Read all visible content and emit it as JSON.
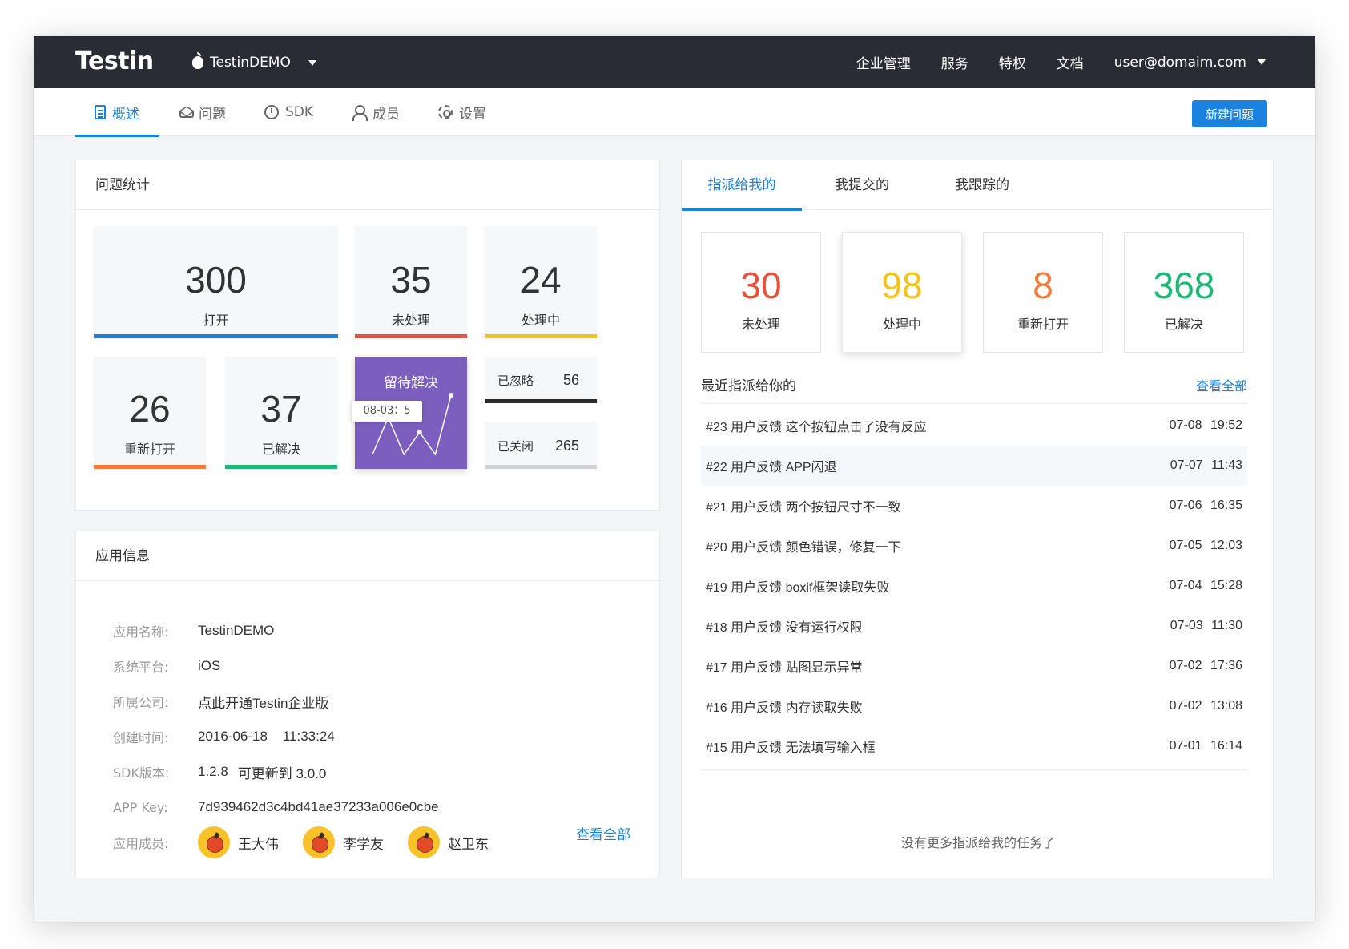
{
  "header": {
    "logo": "Testin",
    "app_name": "TestinDEMO",
    "nav": [
      "企业管理",
      "服务",
      "特权",
      "文档"
    ],
    "user": "user@domaim.com"
  },
  "subnav": {
    "tabs": [
      {
        "label": "概述",
        "icon": "doc-icon"
      },
      {
        "label": "问题",
        "icon": "layers-icon"
      },
      {
        "label": "SDK",
        "icon": "clock-icon"
      },
      {
        "label": "成员",
        "icon": "user-icon"
      },
      {
        "label": "设置",
        "icon": "gear-icon"
      }
    ],
    "new_issue": "新建问题"
  },
  "stats": {
    "title": "问题统计",
    "open": {
      "value": "300",
      "label": "打开",
      "color": "#1f7fd6"
    },
    "unhandled": {
      "value": "35",
      "label": "未处理",
      "color": "#e8523a"
    },
    "processing": {
      "value": "24",
      "label": "处理中",
      "color": "#f5c318"
    },
    "reopened": {
      "value": "26",
      "label": "重新打开",
      "color": "#f57a3a"
    },
    "resolved": {
      "value": "37",
      "label": "已解决",
      "color": "#1db873"
    },
    "pending": {
      "title": "留待解决",
      "tooltip": "08-03：5",
      "trend": [
        0,
        5,
        0,
        3,
        0,
        8
      ],
      "color": "#7b5ebd"
    },
    "ignored": {
      "label": "已忽略",
      "value": "56",
      "color": "#2a2a2a"
    },
    "closed": {
      "label": "已关闭",
      "value": "265",
      "color": "#cfd1d4"
    }
  },
  "appinfo": {
    "title": "应用信息",
    "rows": [
      {
        "key": "应用名称:",
        "value": "TestinDEMO"
      },
      {
        "key": "系统平台:",
        "value": "iOS"
      },
      {
        "key": "所属公司:",
        "value": "点此开通Testin企业版"
      },
      {
        "key": "创建时间:",
        "value": "2016-06-18    11:33:24"
      },
      {
        "key": "SDK版本:",
        "value": "1.2.8",
        "link": "可更新到 3.0.0"
      },
      {
        "key": "APP Key:",
        "value": "7d939462d3c4bd41ae37233a006e0cbe"
      },
      {
        "key": "应用成员:"
      }
    ],
    "members": [
      "王大伟",
      "李学友",
      "赵卫东"
    ],
    "view_all": "查看全部"
  },
  "assigned": {
    "tabs": [
      "指派给我的",
      "我提交的",
      "我跟踪的"
    ],
    "stats": [
      {
        "value": "30",
        "label": "未处理",
        "color": "#e8523a"
      },
      {
        "value": "98",
        "label": "处理中",
        "color": "#f5c318"
      },
      {
        "value": "8",
        "label": "重新打开",
        "color": "#f57a3a"
      },
      {
        "value": "368",
        "label": "已解决",
        "color": "#1db873"
      }
    ],
    "recent_title": "最近指派给你的",
    "view_all": "查看全部",
    "issues": [
      {
        "title": "#23 用户反馈 这个按钮点击了没有反应",
        "date": "07-08  19:52"
      },
      {
        "title": "#22 用户反馈 APP闪退",
        "date": "07-07  11:43"
      },
      {
        "title": "#21 用户反馈 两个按钮尺寸不一致",
        "date": "07-06  16:35"
      },
      {
        "title": "#20 用户反馈 颜色错误，修复一下",
        "date": "07-05  12:03"
      },
      {
        "title": "#19 用户反馈 boxif框架读取失败",
        "date": "07-04  15:28"
      },
      {
        "title": "#18 用户反馈 没有运行权限",
        "date": "07-03  11:30"
      },
      {
        "title": "#17 用户反馈 贴图显示异常",
        "date": "07-02  17:36"
      },
      {
        "title": "#16 用户反馈 内存读取失败",
        "date": "07-02  13:08"
      },
      {
        "title": "#15 用户反馈 无法填写输入框",
        "date": "07-01  16:14"
      }
    ],
    "empty_note": "没有更多指派给我的任务了"
  }
}
